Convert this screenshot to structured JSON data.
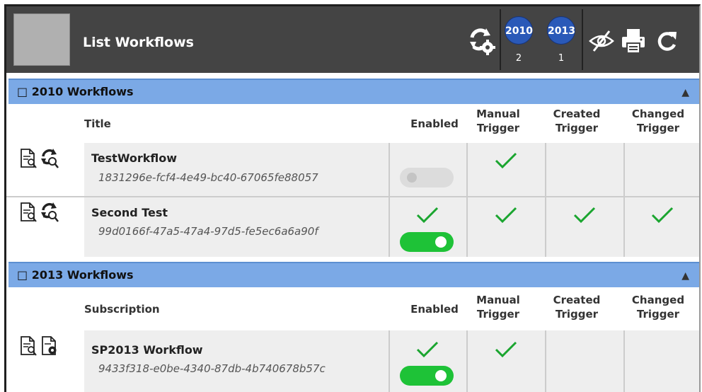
{
  "header": {
    "title": "List Workflows",
    "icons": [
      "workflow-settings-icon",
      "hide-icon",
      "print-icon",
      "refresh-icon"
    ],
    "filters": [
      {
        "year": "2010",
        "count": "2"
      },
      {
        "year": "2013",
        "count": "1"
      }
    ]
  },
  "sections": [
    {
      "title": "□ 2010 Workflows",
      "columns": {
        "name": "Title",
        "enabled": "Enabled",
        "manual": "Manual Trigger",
        "created": "Created Trigger",
        "changed": "Changed Trigger"
      },
      "rows": [
        {
          "name": "TestWorkflow",
          "id": "1831296e-fcf4-4e49-bc40-67065fe88057",
          "enabled": false,
          "enabled_check": false,
          "manual": true,
          "created": false,
          "changed": false
        },
        {
          "name": "Second Test",
          "id": "99d0166f-47a5-47a4-97d5-fe5ec6a6a90f",
          "enabled": true,
          "enabled_check": true,
          "manual": true,
          "created": true,
          "changed": true
        }
      ]
    },
    {
      "title": "□ 2013 Workflows",
      "columns": {
        "name": "Subscription",
        "enabled": "Enabled",
        "manual": "Manual Trigger",
        "created": "Created Trigger",
        "changed": "Changed Trigger"
      },
      "rows": [
        {
          "name": "SP2013 Workflow",
          "id": "9433f318-e0be-4340-87db-4b740678b57c",
          "enabled": true,
          "enabled_check": true,
          "manual": true,
          "created": false,
          "changed": false
        }
      ]
    }
  ],
  "colors": {
    "header_bg": "#444444",
    "section_bar": "#7ba9e6",
    "year_badge": "#2a59b8",
    "check": "#1aa52f",
    "toggle_on": "#1ec237"
  }
}
